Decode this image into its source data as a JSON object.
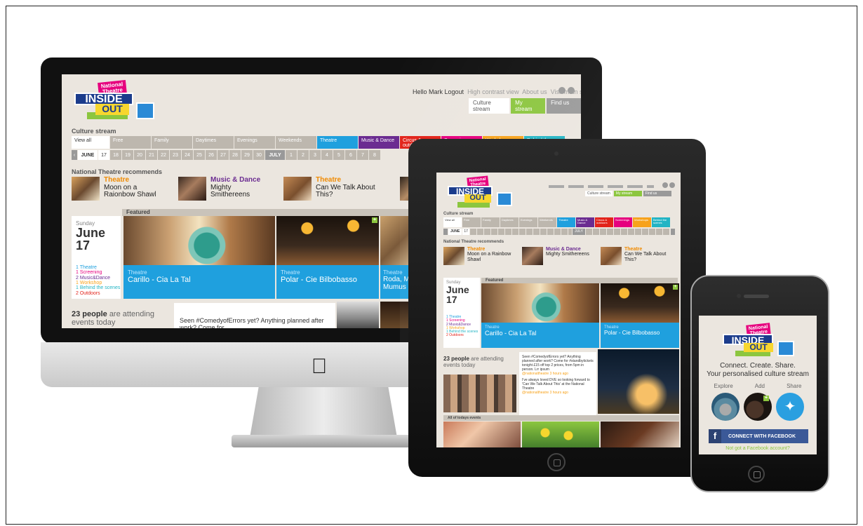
{
  "brand": {
    "logo_line1": "National",
    "logo_line2": "Theatre",
    "logo_inside": "INSIDE",
    "logo_out": "OUT"
  },
  "desktop": {
    "topnav": {
      "greeting": "Hello Mark Logout",
      "high_contrast": "High contrast view",
      "about": "About us",
      "visit": "Visit main site"
    },
    "nav_buttons": [
      "Culture stream",
      "My stream",
      "Find us"
    ],
    "section_culture": "Culture stream",
    "categories": [
      {
        "label": "View all",
        "color": "#ffffff",
        "text": "#333333"
      },
      {
        "label": "Free",
        "color": "#bdb7ae"
      },
      {
        "label": "Family",
        "color": "#bdb7ae"
      },
      {
        "label": "Daytimes",
        "color": "#bdb7ae"
      },
      {
        "label": "Evenings",
        "color": "#bdb7ae"
      },
      {
        "label": "Weekends",
        "color": "#bdb7ae"
      },
      {
        "label": "Theatre",
        "color": "#1fa0de"
      },
      {
        "label": "Music & Dance",
        "color": "#6b2c91"
      },
      {
        "label": "Circus & outdoors",
        "color": "#e2231a"
      },
      {
        "label": "Screenings",
        "color": "#e6007e"
      },
      {
        "label": "Workshops",
        "color": "#f7a21b"
      },
      {
        "label": "Behind the scenes",
        "color": "#22b4c4"
      }
    ],
    "date_strip": {
      "month1": "JUNE",
      "days1": [
        "17",
        "18",
        "19",
        "20",
        "21",
        "22",
        "23",
        "24",
        "25",
        "26",
        "27",
        "28",
        "29",
        "30"
      ],
      "month2": "JULY",
      "days2": [
        "1",
        "2",
        "3",
        "4",
        "5",
        "6",
        "7",
        "8"
      ]
    },
    "section_recommends": "National Theatre recommends",
    "recommends": [
      {
        "category": "Theatre",
        "title": "Moon on a Raionbow Shawl"
      },
      {
        "category": "Music & Dance",
        "title": "Mighty Smithereens"
      },
      {
        "category": "Theatre",
        "title": "Can We Talk About This?"
      }
    ],
    "featured_label": "Featured",
    "date_panel": {
      "dow": "Sunday",
      "month": "June",
      "day": "17",
      "counts": [
        "1 Theatre",
        "1 Screening",
        "2 Music&Dance",
        "1 Workshop",
        "1 Behind the scenes",
        "2 Outdoors"
      ]
    },
    "featured": [
      {
        "category": "Theatre",
        "title": "Carillo - Cia La Tal"
      },
      {
        "category": "Theatre",
        "title": "Polar - Cie Bilbobasso"
      },
      {
        "category": "Theatre",
        "title": "Roda, M Mumus"
      }
    ],
    "attending_count": "23 people",
    "attending_rest": "are attending events today",
    "tweet": "Seen #ComedyofErrors yet? Anything planned after work? Come for"
  },
  "tablet": {
    "nav_buttons": [
      "Culture stream",
      "My stream",
      "Find us"
    ],
    "section_culture": "Culture stream",
    "month1": "JUNE",
    "day_sel": "17",
    "month2": "JULY",
    "section_recommends": "National Theatre recommends",
    "recommends": [
      {
        "category": "Theatre",
        "title": "Moon on a Rainbow Shawl"
      },
      {
        "category": "Music & Dance",
        "title": "Mighty Smithereens"
      },
      {
        "category": "Theatre",
        "title": "Can We Talk About This?"
      }
    ],
    "featured_label": "Featured",
    "date_panel": {
      "dow": "Sunday",
      "month": "June",
      "day": "17",
      "counts": [
        "1 Theatre",
        "1 Screening",
        "2 Music&Dance",
        "1 Workshop",
        "1 Behind the scenes",
        "2 Outdoors"
      ]
    },
    "featured": [
      {
        "category": "Theatre",
        "title": "Carillo - Cia La Tal"
      },
      {
        "category": "Theatre",
        "title": "Polar - Cie Bilbobasso"
      }
    ],
    "attending_count": "23 people",
    "attending_rest": "are attending events today",
    "tweet1": "Seen #ComedyofErrors yet? Anything planned after work? Come for #standbytickets tonight £15 off top 2 prices, from 5pm in person. Lrr ipsum",
    "tweet1_meta": "@nationaltheatre 3 hours ago",
    "tweet2": "I've always loved DVE so looking forward to 'Can We Talk About This' at the National Theatre",
    "tweet2_meta": "@nationaltheatre 3 hours ago",
    "all_events_label": "All of todays events"
  },
  "phone": {
    "tagline1": "Connect. Create. Share.",
    "tagline2": "Your personalised culture stream",
    "tabs": [
      "Explore",
      "Add",
      "Share"
    ],
    "fb_button": "CONNECT WITH FACEBOOK",
    "fb_link": "Not got a Facebook account?"
  },
  "colors": {
    "theatre_blue": "#1fa0de",
    "brand_pink": "#e6007e",
    "brand_navy": "#1b3c8c",
    "brand_yellow": "#f7d62e",
    "accent_green": "#8cc63f",
    "facebook": "#3b5998",
    "twitter": "#2a9fe0"
  }
}
